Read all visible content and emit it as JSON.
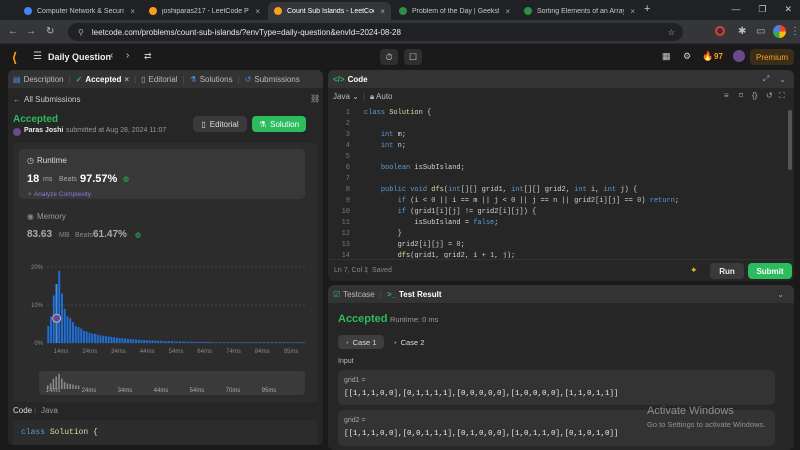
{
  "browser": {
    "tabs": [
      {
        "label": "Computer Network & Security",
        "color": "#4285f4",
        "active": false
      },
      {
        "label": "joshiparas217 - LeetCode Profi",
        "color": "#f89f1b",
        "active": false
      },
      {
        "label": "Count Sub Islands - LeetCode",
        "color": "#f89f1b",
        "active": true
      },
      {
        "label": "Problem of the Day | GeeksforG",
        "color": "#2f8d46",
        "active": false
      },
      {
        "label": "Sorting Elements of an Array by",
        "color": "#2f8d46",
        "active": false
      }
    ],
    "new_tab": "+",
    "url": "leetcode.com/problems/count-sub-islands/?envType=daily-question&envId=2024-08-28"
  },
  "nav": {
    "title": "Daily Question",
    "streak": "97",
    "premium": "Premium"
  },
  "left": {
    "tabs": [
      {
        "label": "Description",
        "active": false
      },
      {
        "label": "Accepted",
        "active": true
      },
      {
        "label": "Editorial",
        "active": false
      },
      {
        "label": "Solutions",
        "active": false
      },
      {
        "label": "Submissions",
        "active": false
      }
    ],
    "all_submissions": "All Submissions",
    "status": "Accepted",
    "user": "Paras Joshi",
    "submitted": "submitted at Aug 28, 2024 11:07",
    "editorial_btn": "Editorial",
    "solution_btn": "Solution",
    "runtime": {
      "title": "Runtime",
      "value": "18",
      "unit": "ms",
      "beats_label": "Beats",
      "beats": "97.57%",
      "analyze": "Analyze Complexity"
    },
    "memory": {
      "title": "Memory",
      "value": "83.63",
      "unit": "MB",
      "beats_label": "Beats",
      "beats": "61.47%"
    },
    "chart_data": {
      "type": "bar",
      "y_ticks": [
        "20%",
        "10%",
        "0%"
      ],
      "ylim": [
        0,
        20
      ],
      "x_ticks": [
        "14ms",
        "24ms",
        "34ms",
        "44ms",
        "54ms",
        "64ms",
        "74ms",
        "84ms",
        "95ms"
      ],
      "values": [
        4.5,
        7,
        12.5,
        15.5,
        19,
        13,
        9,
        7,
        6.5,
        5.5,
        4.5,
        4.2,
        3.8,
        3.2,
        3,
        2.7,
        2.5,
        2.4,
        2.2,
        2,
        1.9,
        1.8,
        1.7,
        1.6,
        1.5,
        1.4,
        1.3,
        1.2,
        1.2,
        1.1,
        1,
        1,
        0.9,
        0.9,
        0.8,
        0.8,
        0.7,
        0.7,
        0.7,
        0.6,
        0.6,
        0.6,
        0.5,
        0.5,
        0.5,
        0.5,
        0.4,
        0.4,
        0.4,
        0.4,
        0.4,
        0.3,
        0.3,
        0.3,
        0.3,
        0.3,
        0.3,
        0.3,
        0.3,
        0.3,
        0.2,
        0.2,
        0.2,
        0.2,
        0.2,
        0.2,
        0.2,
        0.2,
        0.2,
        0.2,
        0.2,
        0.2,
        0.2,
        0.2,
        0.2,
        0.2,
        0.2,
        0.2,
        0.2,
        0.2,
        0.2,
        0.2,
        0.2,
        0.2,
        0.2,
        0.2,
        0.2,
        0.2,
        0.2,
        0.2,
        0.2,
        0.2,
        0.2,
        0.2
      ],
      "highlight_index": 3,
      "mini_x_ticks": [
        "14ms",
        "24ms",
        "34ms",
        "44ms",
        "54ms",
        "70ms",
        "95ms"
      ]
    },
    "code_lang_label": "Code",
    "code_lang": "Java",
    "code_preview": "class Solution {"
  },
  "code": {
    "title": "Code",
    "lang": "Java",
    "auto": "Auto",
    "lines": [
      "class Solution {",
      "",
      "    int m;",
      "    int n;",
      "",
      "    boolean isSubIsland;",
      "",
      "    public void dfs(int[][] grid1, int[][] grid2, int i, int j) {",
      "        if (i < 0 || i == m || j < 0 || j == n || grid2[i][j] == 0) return;",
      "        if (grid1[i][j] != grid2[i][j]) {",
      "            isSubIsland = false;",
      "        }",
      "        grid2[i][j] = 0;",
      "        dfs(grid1, grid2, i + 1, j);",
      "        dfs(grid1, grid2, i - 1, j);",
      "        dfs(grid1, grid2, i, j + 1);"
    ],
    "status": "Ln 7, Col 1",
    "saved": "Saved",
    "run": "Run",
    "submit": "Submit"
  },
  "result": {
    "tab_testcase": "Testcase",
    "tab_result": "Test Result",
    "status": "Accepted",
    "runtime": "Runtime: 0 ms",
    "cases": [
      "Case 1",
      "Case 2"
    ],
    "input_label": "Input",
    "grid1_label": "grid1 =",
    "grid1": "[[1,1,1,0,0],[0,1,1,1,1],[0,0,0,0,0],[1,0,0,0,0],[1,1,0,1,1]]",
    "grid2_label": "grid2 =",
    "grid2": "[[1,1,1,0,0],[0,0,1,1,1],[0,1,0,0,0],[1,0,1,1,0],[0,1,0,1,0]]"
  },
  "watermark": {
    "title": "Activate Windows",
    "sub": "Go to Settings to activate Windows."
  },
  "colors": {
    "green": "#2cbb5d",
    "accent_blue": "#1e88e5",
    "orange": "#ffa116"
  }
}
